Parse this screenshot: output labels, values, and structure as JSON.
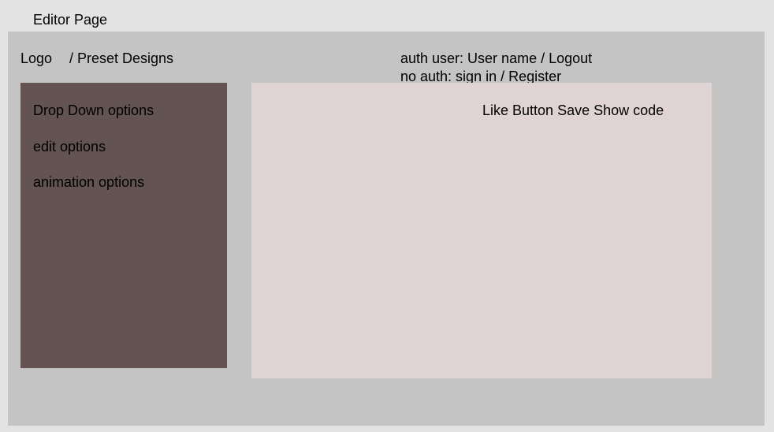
{
  "page": {
    "title": "Editor Page"
  },
  "header": {
    "logo": "Logo",
    "preset_link": "/ Preset Designs",
    "auth_user": "auth user: User name / Logout",
    "no_auth": "no auth: sign in / Register"
  },
  "sidebar": {
    "items": [
      {
        "label": "Drop Down options"
      },
      {
        "label": "edit options"
      },
      {
        "label": "animation options"
      }
    ]
  },
  "canvas": {
    "actions": "Like Button Save Show code"
  },
  "colors": {
    "page_bg": "#e3e3e3",
    "frame_bg": "#c4c4c4",
    "sidebar_bg": "#635452",
    "canvas_bg": "#e0d3d3"
  }
}
